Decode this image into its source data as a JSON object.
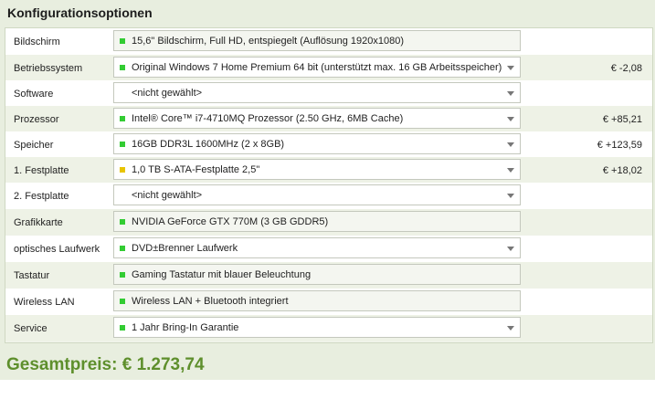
{
  "title": "Konfigurationsoptionen",
  "colors": {
    "green": "#33cc33",
    "yellow": "#e8c400",
    "accent": "#5e8f2c"
  },
  "rows": [
    {
      "label": "Bildschirm",
      "value": "15,6\" Bildschirm, Full HD, entspiegelt (Auflösung 1920x1080)",
      "price": "",
      "status": "green",
      "dropdown": false
    },
    {
      "label": "Betriebssystem",
      "value": "Original Windows 7 Home Premium 64 bit (unterstützt max. 16 GB Arbeitsspeicher)",
      "price": "€ -2,08",
      "status": "green",
      "dropdown": true
    },
    {
      "label": "Software",
      "value": "<nicht gewählt>",
      "price": "",
      "status": "none",
      "dropdown": true
    },
    {
      "label": "Prozessor",
      "value": "Intel® Core™ i7-4710MQ Prozessor (2.50 GHz, 6MB Cache)",
      "price": "€ +85,21",
      "status": "green",
      "dropdown": true
    },
    {
      "label": "Speicher",
      "value": "16GB DDR3L 1600MHz (2 x 8GB)",
      "price": "€ +123,59",
      "status": "green",
      "dropdown": true
    },
    {
      "label": "1. Festplatte",
      "value": "1,0 TB S-ATA-Festplatte 2,5\"",
      "price": "€ +18,02",
      "status": "yellow",
      "dropdown": true
    },
    {
      "label": "2. Festplatte",
      "value": "<nicht gewählt>",
      "price": "",
      "status": "none",
      "dropdown": true
    },
    {
      "label": "Grafikkarte",
      "value": "NVIDIA GeForce GTX 770M (3 GB GDDR5)",
      "price": "",
      "status": "green",
      "dropdown": false
    },
    {
      "label": "optisches Laufwerk",
      "value": "DVD±Brenner Laufwerk",
      "price": "",
      "status": "green",
      "dropdown": true
    },
    {
      "label": "Tastatur",
      "value": "Gaming Tastatur mit blauer Beleuchtung",
      "price": "",
      "status": "green",
      "dropdown": false
    },
    {
      "label": "Wireless LAN",
      "value": "Wireless LAN + Bluetooth integriert",
      "price": "",
      "status": "green",
      "dropdown": false
    },
    {
      "label": "Service",
      "value": "1 Jahr Bring-In Garantie",
      "price": "",
      "status": "green",
      "dropdown": true
    }
  ],
  "total": "Gesamtpreis: € 1.273,74"
}
